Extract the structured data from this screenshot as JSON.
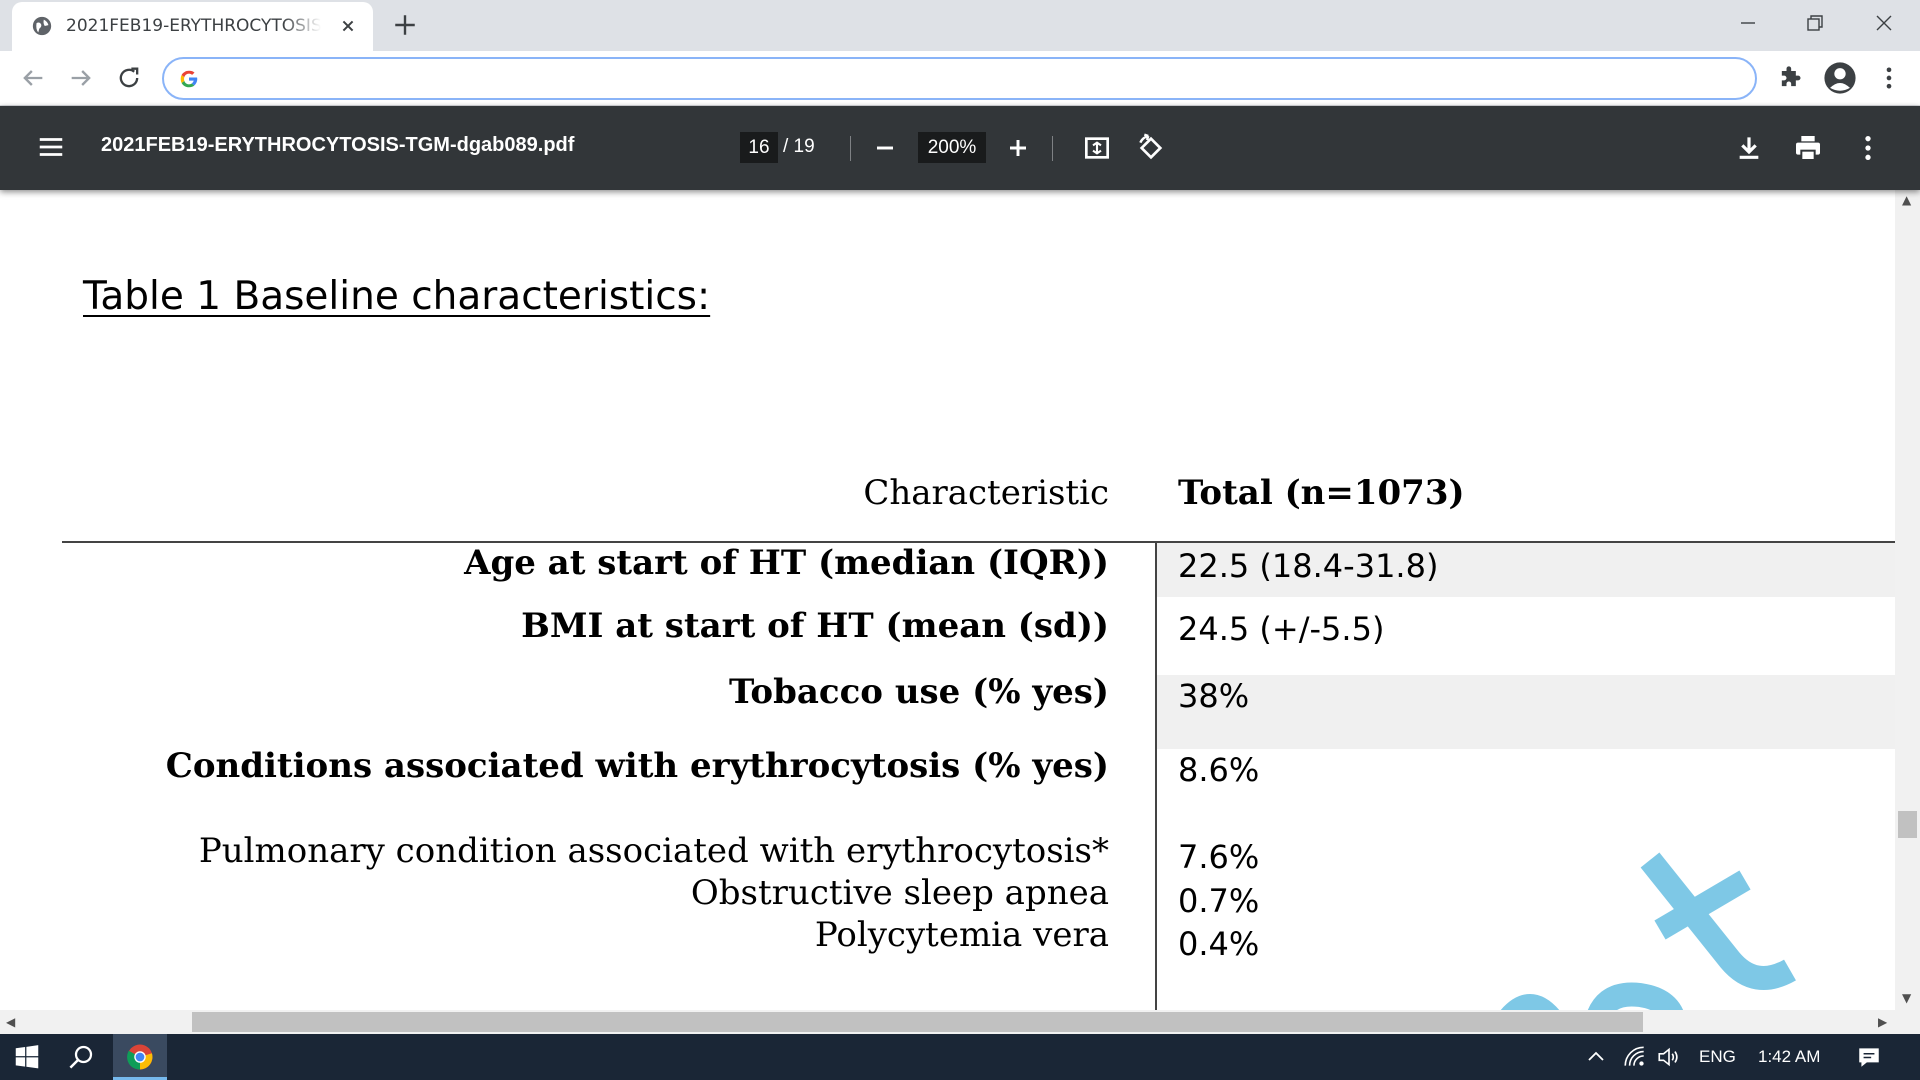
{
  "browser": {
    "tab_title": "2021FEB19-ERYTHROCYTOSIS-TGM-dgab089.pdf",
    "address_value": ""
  },
  "pdf_toolbar": {
    "file_name": "2021FEB19-ERYTHROCYTOSIS-TGM-dgab089.pdf",
    "current_page": "16",
    "page_total": "/ 19",
    "zoom": "200%"
  },
  "document": {
    "heading": "Table 1 Baseline characteristics:",
    "table": {
      "header_label": "Characteristic",
      "header_value": "Total (n=1073)",
      "rows": [
        {
          "label": "Age at start of HT (median (IQR))",
          "value": "22.5 (18.4-31.8)"
        },
        {
          "label": "BMI at start of HT (mean (sd))",
          "value": "24.5 (+/-5.5)"
        },
        {
          "label": "Tobacco use (% yes)",
          "value": "38%"
        },
        {
          "label": "Conditions associated with erythrocytosis (% yes)",
          "value": "8.6%"
        },
        {
          "label": "Pulmonary condition associated with erythrocytosis*",
          "value": "7.6%"
        },
        {
          "label": "Obstructive sleep apnea",
          "value": "0.7%"
        },
        {
          "label": "Polycytemia vera",
          "value": "0.4%"
        }
      ]
    },
    "watermark_color": "#7ec8e6"
  },
  "taskbar": {
    "language": "ENG",
    "time": "1:42 AM"
  },
  "colors": {
    "pdf_toolbar_bg": "#323639",
    "omnibox_focus": "#8ab4f8",
    "taskbar_bg": "#1a2636"
  }
}
